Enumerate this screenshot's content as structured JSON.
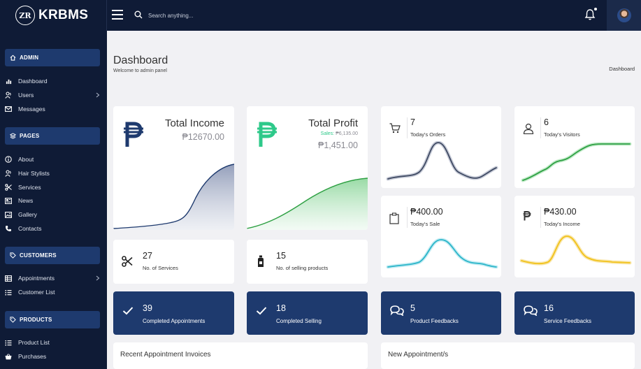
{
  "brand": {
    "logo_text": "ZR",
    "name": "KRBMS"
  },
  "header": {
    "search_placeholder": "Search anything..."
  },
  "sidebar": {
    "admin": {
      "label": "ADMIN",
      "items": [
        {
          "label": "Dashboard"
        },
        {
          "label": "Users"
        },
        {
          "label": "Messages"
        }
      ]
    },
    "pages": {
      "label": "PAGES",
      "items": [
        {
          "label": "About"
        },
        {
          "label": "Hair Stylists"
        },
        {
          "label": "Services"
        },
        {
          "label": "News"
        },
        {
          "label": "Gallery"
        },
        {
          "label": "Contacts"
        }
      ]
    },
    "customers": {
      "label": "CUSTOMERS",
      "items": [
        {
          "label": "Appointments"
        },
        {
          "label": "Customer List"
        }
      ]
    },
    "products": {
      "label": "PRODUCTS",
      "items": [
        {
          "label": "Product List"
        },
        {
          "label": "Purchases"
        }
      ]
    }
  },
  "page": {
    "title": "Dashboard",
    "subtitle": "Welcome to admin panel",
    "breadcrumb": "Dashboard"
  },
  "stats": {
    "total_income": {
      "title": "Total Income",
      "amount": "₱12670.00"
    },
    "total_profit": {
      "title": "Total Profit",
      "sales_label": "Sales:",
      "sales_value": "₱6,135.00",
      "amount": "₱1,451.00"
    },
    "todays_orders": {
      "value": "7",
      "label": "Today's Orders"
    },
    "todays_visitors": {
      "value": "6",
      "label": "Today's Visitors"
    },
    "todays_sale": {
      "value": "₱400.00",
      "label": "Today's Sale"
    },
    "todays_income": {
      "value": "₱430.00",
      "label": "Today's Income"
    },
    "services": {
      "value": "27",
      "label": "No. of Services"
    },
    "selling_products": {
      "value": "15",
      "label": "No. of selling products"
    },
    "completed_appointments": {
      "value": "39",
      "label": "Completed Appointments"
    },
    "completed_selling": {
      "value": "18",
      "label": "Completed Selling"
    },
    "product_feedbacks": {
      "value": "5",
      "label": "Product Feedbacks"
    },
    "service_feedbacks": {
      "value": "16",
      "label": "Service Feedbacks"
    }
  },
  "panels": {
    "recent_invoices": "Recent Appointment Invoices",
    "new_appointments": "New Appointment/s"
  },
  "colors": {
    "navy": "#0f1b36",
    "accent": "#1e3a6e",
    "green": "#2ea043",
    "cyan": "#2bb5c9",
    "yellow": "#f1c21b",
    "slate": "#4a5878"
  }
}
